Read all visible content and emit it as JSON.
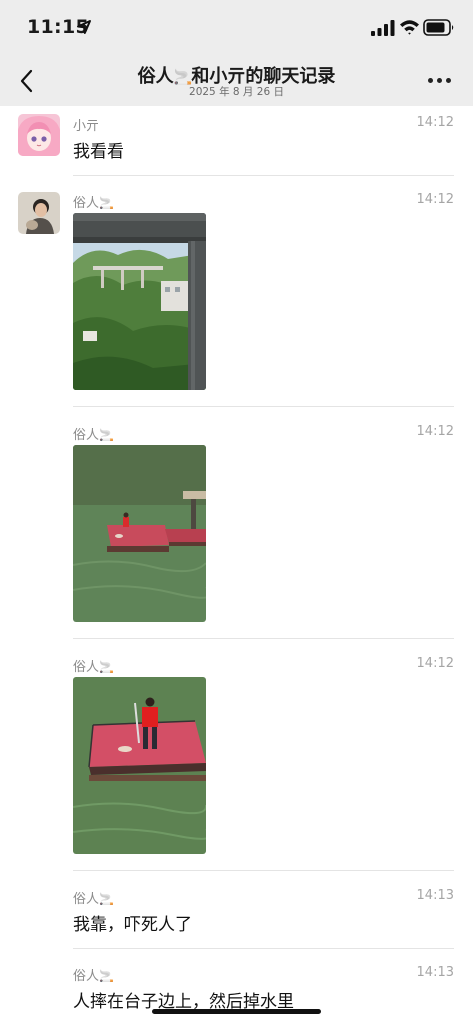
{
  "status": {
    "time": "11:15"
  },
  "header": {
    "title_prefix": "俗人",
    "title_suffix": "和小亓的聊天记录",
    "cigarette_emoji": "🚬",
    "date": "2025 年 8 月 26 日"
  },
  "messages": [
    {
      "sender": "小亓",
      "time": "14:12",
      "text": "我看看"
    },
    {
      "sender": "俗人",
      "time": "14:12",
      "image": "photo of green mountain valley under an overpass"
    },
    {
      "sender": "俗人",
      "time": "14:12",
      "image": "photo of a red floating platform on a green river"
    },
    {
      "sender": "俗人",
      "time": "14:12",
      "image": "close-up photo of a person in red standing on the red platform"
    },
    {
      "sender": "俗人",
      "time": "14:13",
      "text": "我靠，吓死人了"
    },
    {
      "sender": "俗人",
      "time": "14:13",
      "text": "人摔在台子边上，然后掉水里"
    }
  ],
  "icons": {
    "back": "chevron-left-icon",
    "more": "more-dots-icon",
    "location": "location-arrow-icon",
    "signal": "signal-bars-icon",
    "wifi": "wifi-icon",
    "battery": "battery-icon"
  },
  "colors": {
    "bar_bg": "#ededed",
    "divider": "#e4e4e4",
    "meta_text": "#8c8c8c"
  }
}
